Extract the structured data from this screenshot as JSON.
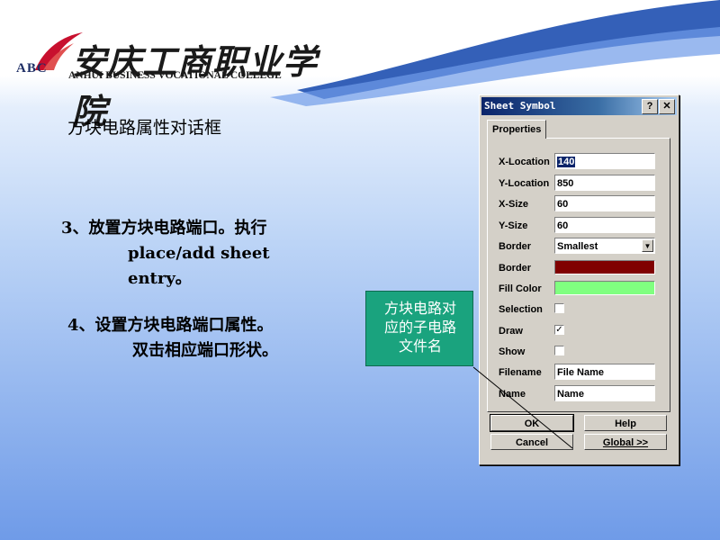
{
  "logo": {
    "abc": "ABC",
    "chinese": "安庆工商职业学院",
    "english": "ANHUI BUSINESS VOCATIONAL COLLEGE"
  },
  "slide": {
    "title": "方块电路属性对话框",
    "step3_line1": "3、放置方块电路端口。执行",
    "step3_line2": "place/add sheet entry。",
    "step4_line1": "4、设置方块电路端口属性。",
    "step4_line2": "双击相应端口形状。"
  },
  "callout": {
    "line1": "方块电路对",
    "line2": "应的子电路",
    "line3": "文件名",
    "color": "#1aa37e"
  },
  "dialog": {
    "title": "Sheet Symbol",
    "help_glyph": "?",
    "close_glyph": "✕",
    "tab": "Properties",
    "fields": {
      "x_location": {
        "label": "X-Location",
        "value": "140"
      },
      "y_location": {
        "label": "Y-Location",
        "value": "850"
      },
      "x_size": {
        "label": "X-Size",
        "value": "60"
      },
      "y_size": {
        "label": "Y-Size",
        "value": "60"
      },
      "border_width": {
        "label": "Border",
        "value": "Smallest"
      },
      "border_color": {
        "label": "Border",
        "color": "#800000"
      },
      "fill_color": {
        "label": "Fill Color",
        "color": "#80ff80"
      },
      "selection": {
        "label": "Selection",
        "checked": false
      },
      "draw": {
        "label": "Draw",
        "checked": true
      },
      "show": {
        "label": "Show",
        "checked": false
      },
      "filename": {
        "label": "Filename",
        "value": "File Name"
      },
      "name": {
        "label": "Name",
        "value": "Name"
      }
    },
    "buttons": {
      "ok": "OK",
      "help": "Help",
      "cancel": "Cancel",
      "global": "Global >>"
    }
  },
  "colors": {
    "title_bar": "#0a246a",
    "logo_red": "#c8102e",
    "header_swoosh": "#1e4fb0"
  }
}
